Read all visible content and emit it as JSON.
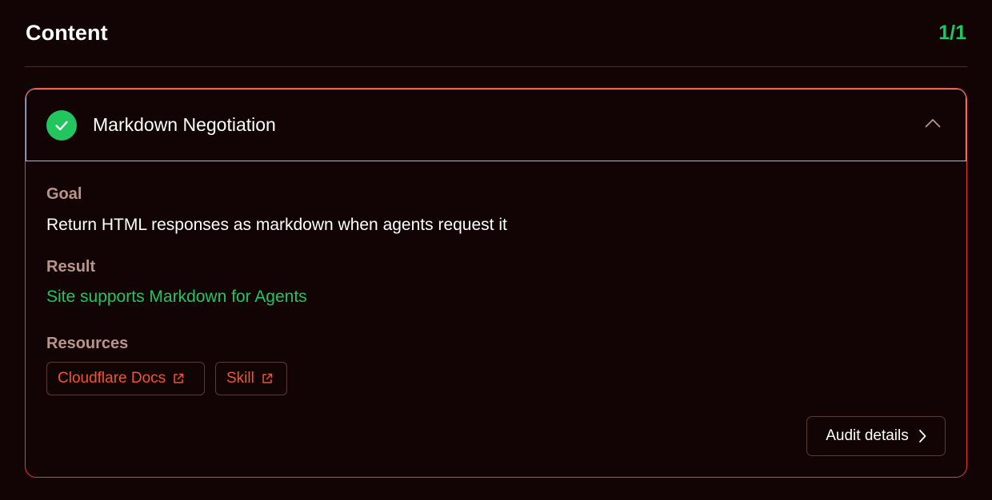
{
  "section": {
    "title": "Content",
    "count": "1/1",
    "accent_color": "#22c55e"
  },
  "card": {
    "title": "Markdown Negotiation",
    "status": "passed",
    "status_icon": "check-circle-icon",
    "expanded": true,
    "border_color": "#e2422a",
    "goal_label": "Goal",
    "goal_text": "Return HTML responses as markdown when agents request it",
    "result_label": "Result",
    "result_text": "Site supports Markdown for Agents",
    "resources_label": "Resources",
    "resources": [
      {
        "label": "Cloudflare Docs",
        "icon": "external-link-icon"
      },
      {
        "label": "Skill",
        "icon": "external-link-icon"
      }
    ],
    "audit_label": "Audit details",
    "link_color": "#f2542d"
  }
}
